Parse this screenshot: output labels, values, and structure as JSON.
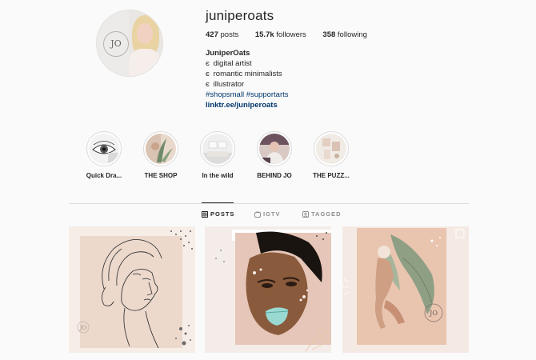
{
  "profile": {
    "username": "juniperoats",
    "avatar_logo": "JO",
    "stats": {
      "posts_count": "427",
      "posts_label": "posts",
      "followers_count": "15.7k",
      "followers_label": "followers",
      "following_count": "358",
      "following_label": "following"
    },
    "bio": {
      "name": "JuniperOats",
      "bullet": "є",
      "lines": [
        "digital artist",
        "romantic minimalists",
        "illustrator"
      ],
      "hashtags": "#shopsmall #supportarts",
      "link": "linktr.ee/juniperoats"
    }
  },
  "highlights": [
    {
      "label": "Quick Dra...",
      "icon": "eye-sketch"
    },
    {
      "label": "THE SHOP",
      "icon": "plant-art"
    },
    {
      "label": "In the wild",
      "icon": "room-interior"
    },
    {
      "label": "BEHIND JO",
      "icon": "person-portrait"
    },
    {
      "label": "THE PUZZ...",
      "icon": "puzzle-pieces"
    }
  ],
  "tabs": [
    {
      "label": "POSTS",
      "icon": "grid-icon",
      "active": true
    },
    {
      "label": "IGTV",
      "icon": "igtv-icon",
      "active": false
    },
    {
      "label": "TAGGED",
      "icon": "tagged-icon",
      "active": false
    }
  ],
  "posts": [
    {
      "subject": "line-drawing-face",
      "logo": "JO"
    },
    {
      "subject": "painted-portrait"
    },
    {
      "subject": "woman-with-palm-leaves",
      "logo": "JO"
    }
  ],
  "colors": {
    "link": "#00376b",
    "text": "#262626",
    "muted": "#8e8e8e",
    "divider": "#dbdbdb",
    "background": "#fafafa"
  }
}
